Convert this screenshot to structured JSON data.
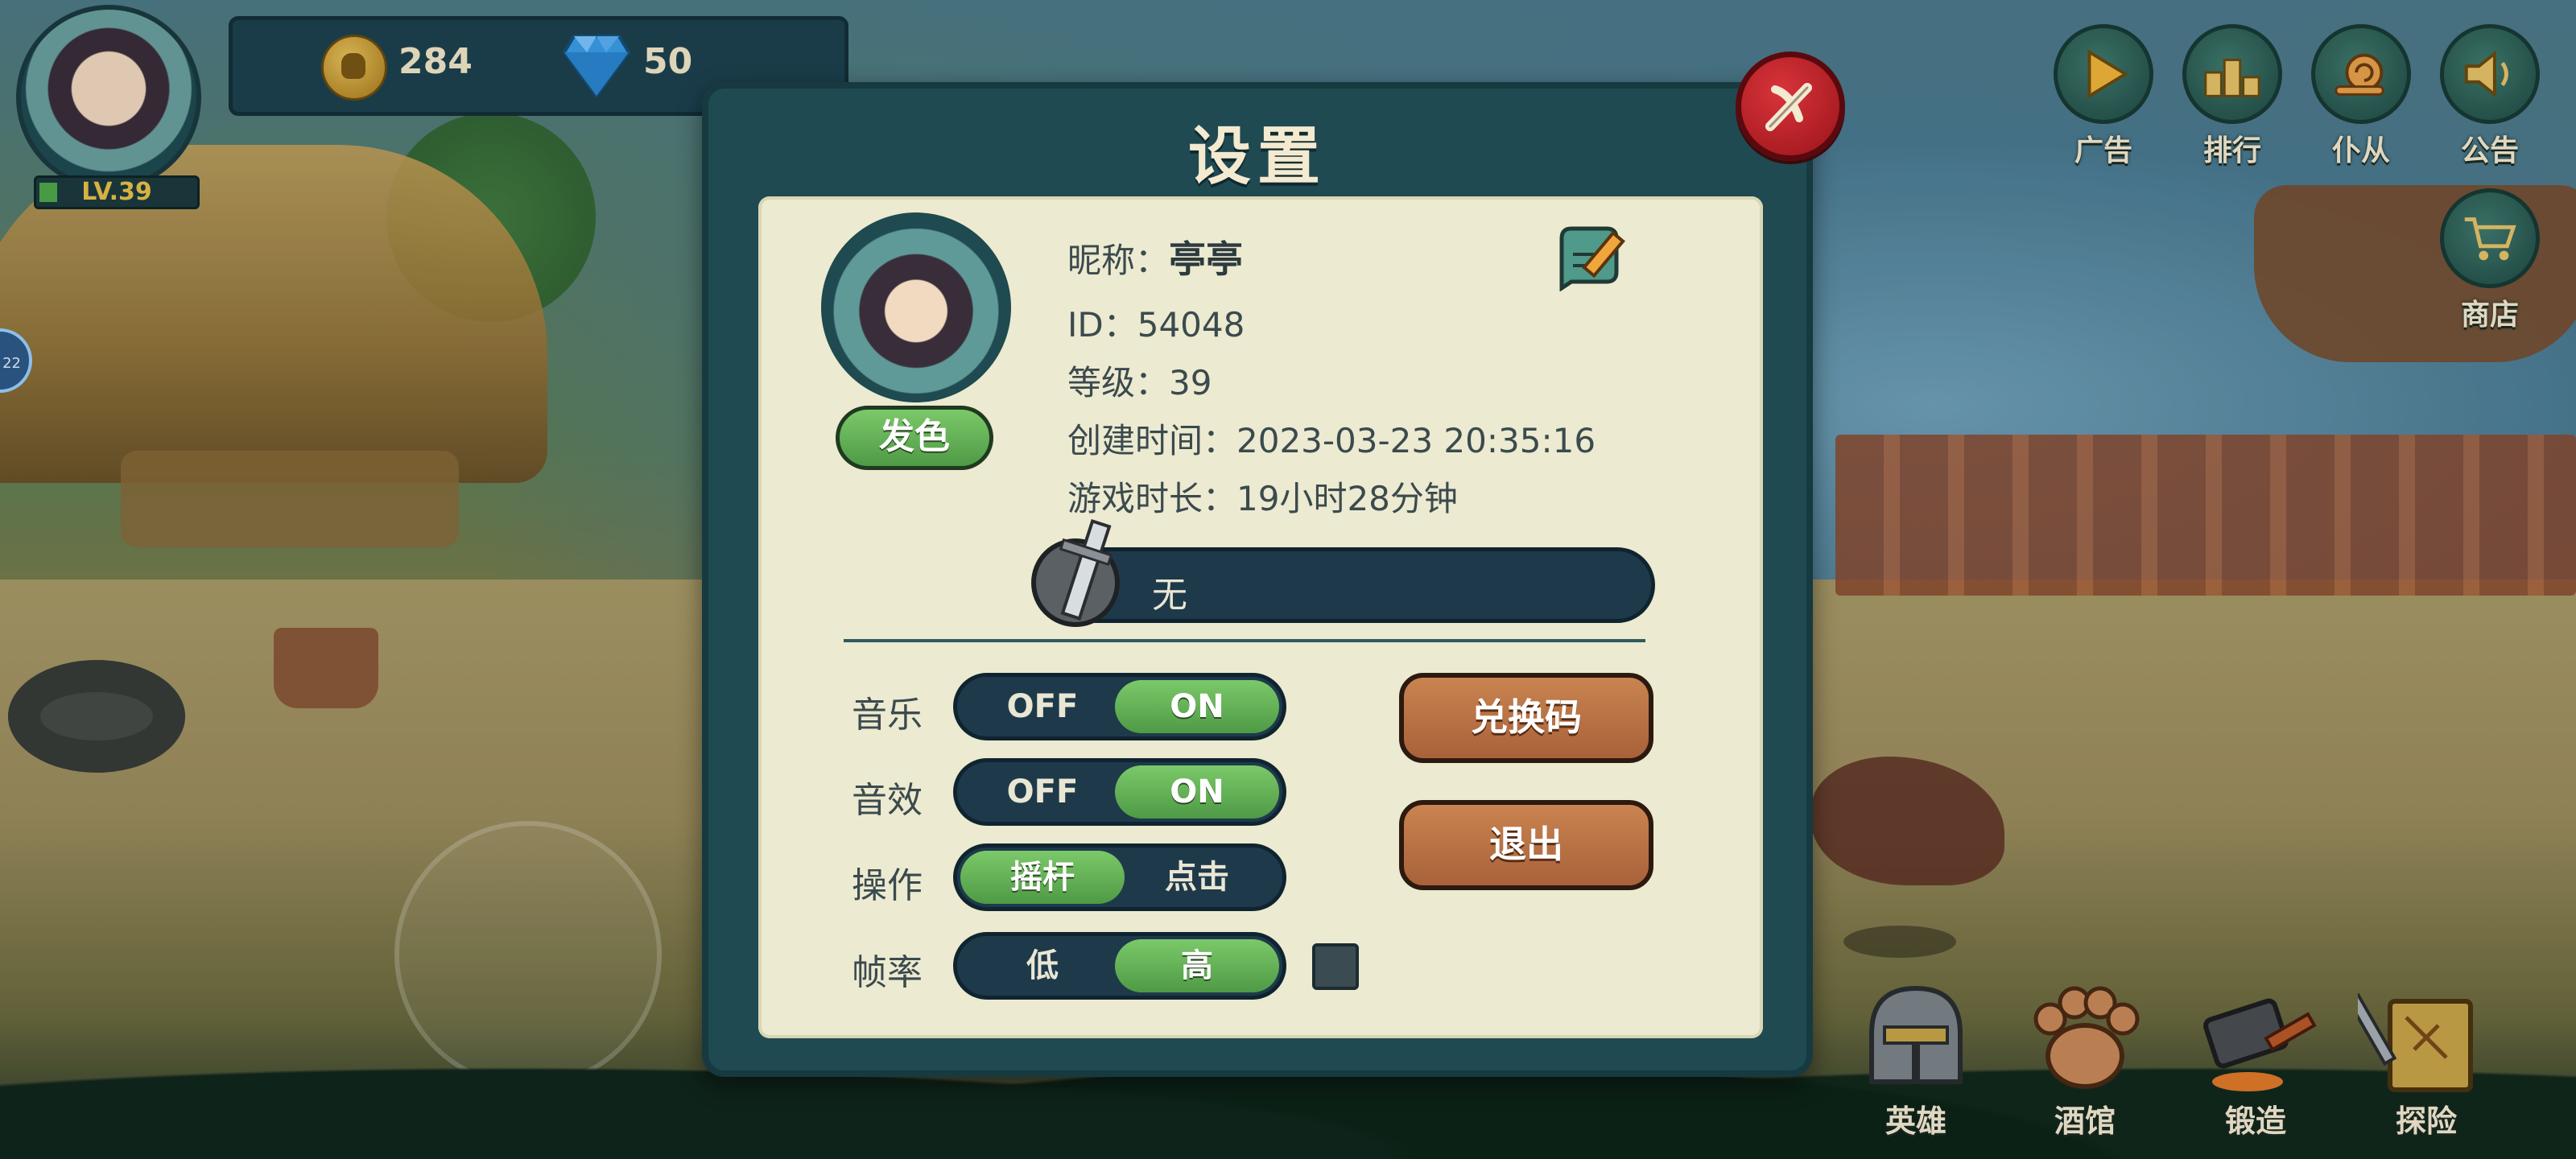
{
  "hud": {
    "level": "LV.39",
    "coins": "284",
    "gems": "50",
    "edge_badge": "22"
  },
  "top_menu": [
    {
      "label": "广告",
      "icon": "play-icon"
    },
    {
      "label": "排行",
      "icon": "podium-icon"
    },
    {
      "label": "仆从",
      "icon": "snail-icon"
    },
    {
      "label": "公告",
      "icon": "speaker-icon"
    },
    {
      "label": "商店",
      "icon": "cart-icon"
    }
  ],
  "bottom_nav": [
    {
      "label": "英雄",
      "icon": "helmet-icon"
    },
    {
      "label": "酒馆",
      "icon": "paw-icon"
    },
    {
      "label": "锻造",
      "icon": "hammer-icon"
    },
    {
      "label": "探险",
      "icon": "map-sword-icon"
    }
  ],
  "dialog": {
    "title": "设置",
    "dye_button": "发色",
    "nickname_label": "昵称：",
    "nickname": "亭亭",
    "id_line": "ID：54048",
    "level_line": "等级：39",
    "created_line": "创建时间：2023-03-23 20:35:16",
    "playtime_line": "游戏时长：19小时28分钟",
    "title_value": "无",
    "options": [
      {
        "label": "音乐",
        "left": "OFF",
        "right": "ON",
        "selected": "right"
      },
      {
        "label": "音效",
        "left": "OFF",
        "right": "ON",
        "selected": "right"
      },
      {
        "label": "操作",
        "left": "摇杆",
        "right": "点击",
        "selected": "left"
      },
      {
        "label": "帧率",
        "left": "低",
        "right": "高",
        "selected": "right"
      }
    ],
    "redeem_button": "兑换码",
    "logout_button": "退出"
  },
  "colors": {
    "dialog_bg": "#1f4a52",
    "paper": "#ecead0",
    "toggle_active": "#5fb052",
    "action_button": "#b86f45",
    "close_button": "#c0242a"
  }
}
